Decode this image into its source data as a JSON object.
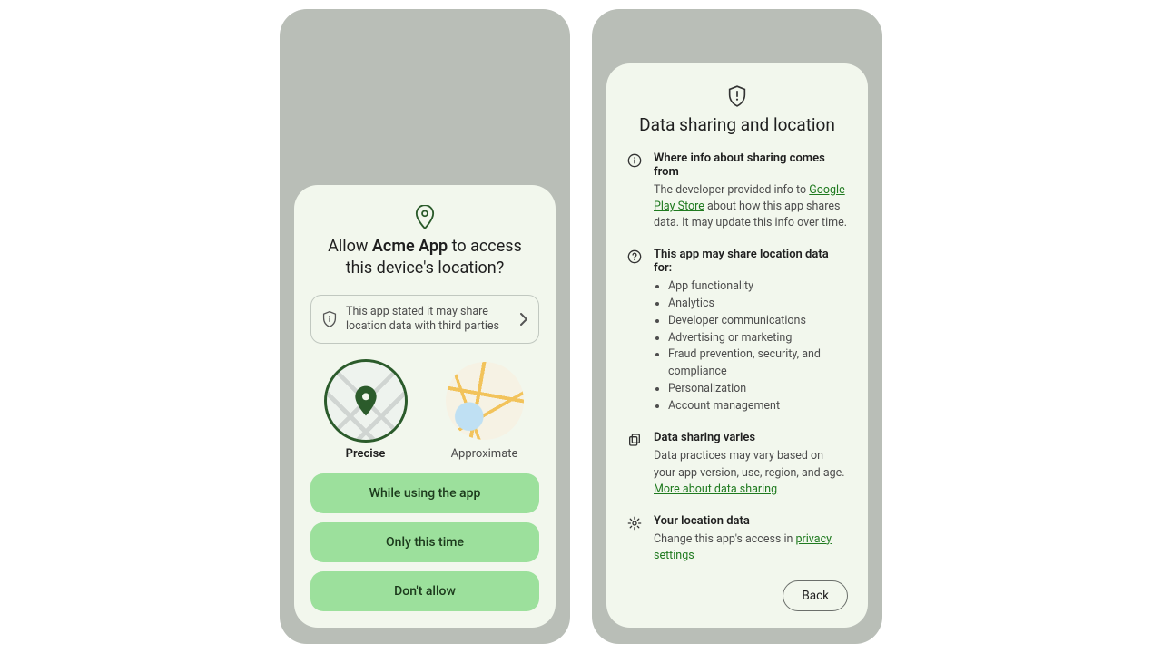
{
  "perm": {
    "app_name": "Acme App",
    "title_pre": "Allow ",
    "title_post": " to access this device's location?",
    "share_notice": "This app stated it may share location data with third parties",
    "options": {
      "precise": "Precise",
      "approximate": "Approximate"
    },
    "buttons": {
      "while_using": "While using the app",
      "only_this_time": "Only this time",
      "dont_allow": "Don't allow"
    }
  },
  "info": {
    "title": "Data sharing and location",
    "sections": {
      "source": {
        "heading": "Where info about sharing comes from",
        "text_pre": "The developer provided info to ",
        "link": "Google Play Store",
        "text_post": " about how this app shares data. It may update this info over time."
      },
      "purposes": {
        "heading": "This app may share location data for:",
        "items": [
          "App functionality",
          "Analytics",
          "Developer communications",
          "Advertising or marketing",
          "Fraud prevention, security, and compliance",
          "Personalization",
          "Account management"
        ]
      },
      "varies": {
        "heading": "Data sharing varies",
        "text_pre": "Data practices may vary based on your app version, use, region, and age. ",
        "link": "More about data sharing"
      },
      "your_data": {
        "heading": "Your location data",
        "text_pre": "Change this app's access in ",
        "link": "privacy settings"
      }
    },
    "back": "Back"
  }
}
